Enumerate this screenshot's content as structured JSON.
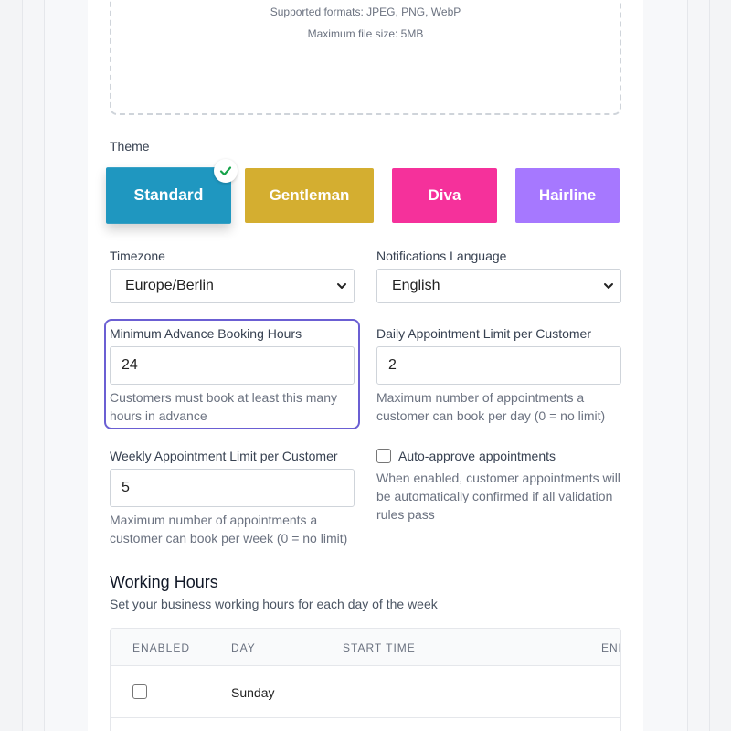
{
  "upload": {
    "formats_text": "Supported formats: JPEG, PNG, WebP",
    "max_size_text": "Maximum file size: 5MB"
  },
  "theme": {
    "label": "Theme",
    "options": [
      {
        "name": "Standard",
        "color": "#1f97c0",
        "selected": true
      },
      {
        "name": "Gentleman",
        "color": "#d4ae30",
        "selected": false
      },
      {
        "name": "Diva",
        "color": "#f5319b",
        "selected": false
      },
      {
        "name": "Hairline",
        "color": "#a678ff",
        "selected": false
      }
    ]
  },
  "timezone": {
    "label": "Timezone",
    "value": "Europe/Berlin"
  },
  "notifications_language": {
    "label": "Notifications Language",
    "value": "English"
  },
  "min_advance": {
    "label": "Minimum Advance Booking Hours",
    "value": "24",
    "help": "Customers must book at least this many hours in advance"
  },
  "daily_limit": {
    "label": "Daily Appointment Limit per Customer",
    "value": "2",
    "help": "Maximum number of appointments a customer can book per day (0 = no limit)"
  },
  "weekly_limit": {
    "label": "Weekly Appointment Limit per Customer",
    "value": "5",
    "help": "Maximum number of appointments a customer can book per week (0 = no limit)"
  },
  "auto_approve": {
    "label": "Auto-approve appointments",
    "checked": false,
    "help": "When enabled, customer appointments will be automatically confirmed if all validation rules pass"
  },
  "working_hours": {
    "title": "Working Hours",
    "subtitle": "Set your business working hours for each day of the week",
    "columns": [
      "ENABLED",
      "DAY",
      "START TIME",
      "END"
    ],
    "rows": [
      {
        "enabled": false,
        "day": "Sunday",
        "start": "—",
        "end": "—"
      }
    ]
  },
  "colors": {
    "focus_ring": "#6b5fd3",
    "check_green": "#16a34a"
  }
}
